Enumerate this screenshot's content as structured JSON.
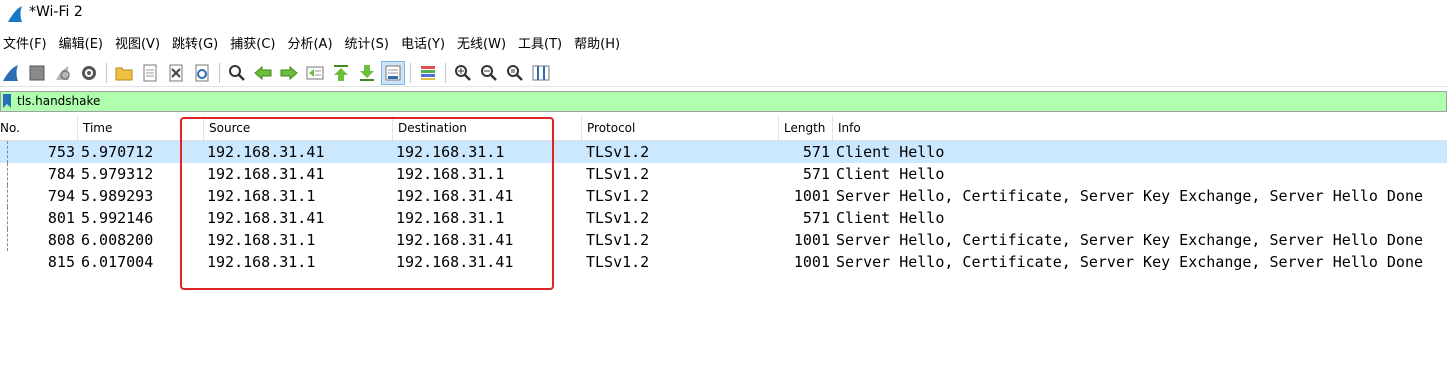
{
  "window": {
    "title": "*Wi-Fi 2"
  },
  "menu": [
    "文件(F)",
    "编辑(E)",
    "视图(V)",
    "跳转(G)",
    "捕获(C)",
    "分析(A)",
    "统计(S)",
    "电话(Y)",
    "无线(W)",
    "工具(T)",
    "帮助(H)"
  ],
  "filter": {
    "value": "tls.handshake"
  },
  "columns": {
    "no": "No.",
    "time": "Time",
    "source": "Source",
    "destination": "Destination",
    "protocol": "Protocol",
    "length": "Length",
    "info": "Info"
  },
  "packets": [
    {
      "no": "753",
      "time": "5.970712",
      "source": "192.168.31.41",
      "destination": "192.168.31.1",
      "protocol": "TLSv1.2",
      "length": "571",
      "info": "Client Hello"
    },
    {
      "no": "784",
      "time": "5.979312",
      "source": "192.168.31.41",
      "destination": "192.168.31.1",
      "protocol": "TLSv1.2",
      "length": "571",
      "info": "Client Hello"
    },
    {
      "no": "794",
      "time": "5.989293",
      "source": "192.168.31.1",
      "destination": "192.168.31.41",
      "protocol": "TLSv1.2",
      "length": "1001",
      "info": "Server Hello, Certificate, Server Key Exchange, Server Hello Done"
    },
    {
      "no": "801",
      "time": "5.992146",
      "source": "192.168.31.41",
      "destination": "192.168.31.1",
      "protocol": "TLSv1.2",
      "length": "571",
      "info": "Client Hello"
    },
    {
      "no": "808",
      "time": "6.008200",
      "source": "192.168.31.1",
      "destination": "192.168.31.41",
      "protocol": "TLSv1.2",
      "length": "1001",
      "info": "Server Hello, Certificate, Server Key Exchange, Server Hello Done"
    },
    {
      "no": "815",
      "time": "6.017004",
      "source": "192.168.31.1",
      "destination": "192.168.31.41",
      "protocol": "TLSv1.2",
      "length": "1001",
      "info": "Server Hello, Certificate, Server Key Exchange, Server Hello Done"
    }
  ],
  "toolbar_icons": [
    "shark-fin-start-icon",
    "stop-icon",
    "restart-icon",
    "options-gear-icon",
    "open-folder-icon",
    "save-file-icon",
    "close-file-icon",
    "reload-icon",
    "find-icon",
    "go-back-icon",
    "go-forward-icon",
    "go-to-packet-icon",
    "first-packet-icon",
    "last-packet-icon",
    "autoscroll-icon",
    "colorize-icon",
    "zoom-in-icon",
    "zoom-out-icon",
    "normal-size-icon",
    "resize-columns-icon"
  ],
  "colors": {
    "filter_bg": "#afffaf",
    "selected_row": "#cce8ff",
    "annotation": "#e02424"
  }
}
